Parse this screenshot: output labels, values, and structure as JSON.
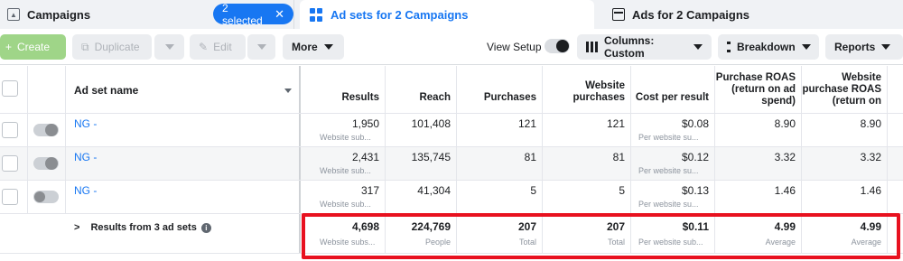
{
  "tabs": {
    "campaigns": "Campaigns",
    "selected_pill": "2 selected",
    "adsets": "Ad sets for 2 Campaigns",
    "ads": "Ads for 2 Campaigns"
  },
  "toolbar": {
    "create": "Create",
    "duplicate": "Duplicate",
    "edit": "Edit",
    "more": "More",
    "view_setup": "View Setup",
    "columns": "Columns: Custom",
    "breakdown": "Breakdown",
    "reports": "Reports"
  },
  "columns": {
    "name": "Ad set name",
    "results": "Results",
    "reach": "Reach",
    "purchases": "Purchases",
    "website_purchases": [
      "Website",
      "purchases"
    ],
    "cost_per_result": "Cost per result",
    "purchase_roas": [
      "Purchase ROAS",
      "(return on ad",
      "spend)"
    ],
    "website_roas": [
      "Website",
      "purchase ROAS",
      "(return on"
    ]
  },
  "rows": [
    {
      "name": "NG -",
      "results": "1,950",
      "results_sub": "Website sub...",
      "reach": "101,408",
      "purchases": "121",
      "website_purchases": "121",
      "cpr": "$0.08",
      "cpr_sub": "Per website su...",
      "roas": "8.90",
      "wroas": "8.90",
      "toggle": "on"
    },
    {
      "name": "NG -",
      "results": "2,431",
      "results_sub": "Website sub...",
      "reach": "135,745",
      "purchases": "81",
      "website_purchases": "81",
      "cpr": "$0.12",
      "cpr_sub": "Per website su...",
      "roas": "3.32",
      "wroas": "3.32",
      "toggle": "on"
    },
    {
      "name": "NG -",
      "results": "317",
      "results_sub": "Website sub...",
      "reach": "41,304",
      "purchases": "5",
      "website_purchases": "5",
      "cpr": "$0.13",
      "cpr_sub": "Per website su...",
      "roas": "1.46",
      "wroas": "1.46",
      "toggle": "off"
    }
  ],
  "totals": {
    "label": "Results from 3 ad sets",
    "results": "4,698",
    "results_sub": "Website subs...",
    "reach": "224,769",
    "reach_sub": "People",
    "purchases": "207",
    "purchases_sub": "Total",
    "website_purchases": "207",
    "website_purchases_sub": "Total",
    "cpr": "$0.11",
    "cpr_sub": "Per website sub...",
    "roas": "4.99",
    "roas_sub": "Average",
    "wroas": "4.99",
    "wroas_sub": "Average"
  },
  "colors": {
    "accent": "#1877f2",
    "highlight": "#e8111f",
    "create": "#9fd588"
  }
}
